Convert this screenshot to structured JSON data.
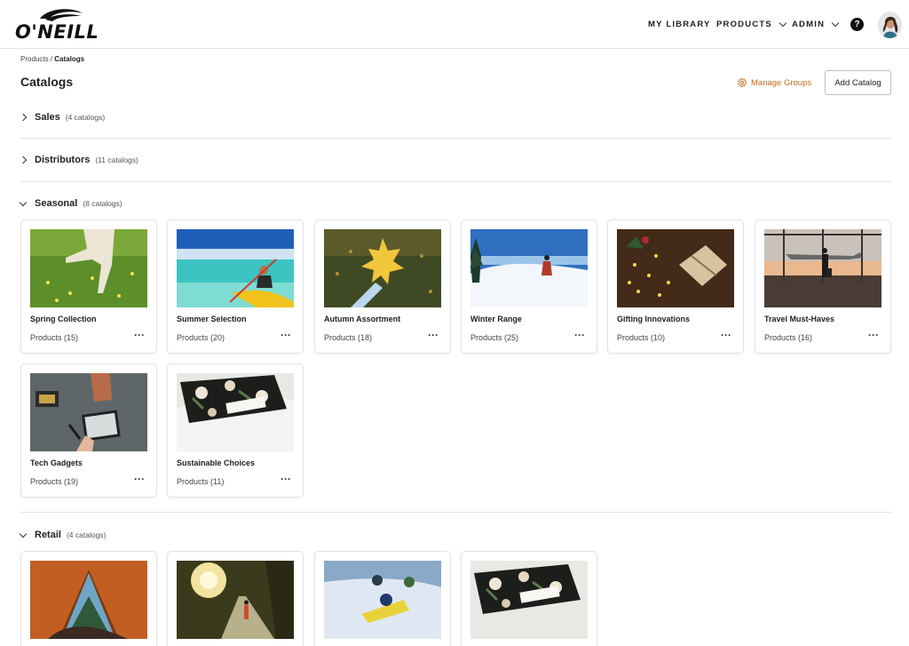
{
  "brand": {
    "logo_text": "O'NEILL"
  },
  "nav": {
    "my_library": "MY LIBRARY",
    "products": "PRODUCTS",
    "admin": "ADMIN",
    "help": "?"
  },
  "breadcrumb": {
    "parent": "Products",
    "separator": " / ",
    "current": "Catalogs"
  },
  "page": {
    "title": "Catalogs",
    "manage_groups": "Manage Groups",
    "add_catalog": "Add Catalog"
  },
  "colors": {
    "accent": "#c26a1f"
  },
  "groups": [
    {
      "name": "Sales",
      "count": "(4 catalogs)",
      "expanded": false
    },
    {
      "name": "Distributors",
      "count": "(11 catalogs)",
      "expanded": false
    },
    {
      "name": "Seasonal",
      "count": "(8 catalogs)",
      "expanded": true,
      "catalogs": [
        {
          "name": "Spring Collection",
          "products": "Products (15)"
        },
        {
          "name": "Summer Selection",
          "products": "Products (20)"
        },
        {
          "name": "Autumn Assortment",
          "products": "Products (18)"
        },
        {
          "name": "Winter Range",
          "products": "Products (25)"
        },
        {
          "name": "Gifting Innovations",
          "products": "Products (10)"
        },
        {
          "name": "Travel Must-Haves",
          "products": "Products (16)"
        },
        {
          "name": "Tech Gadgets",
          "products": "Products (19)"
        },
        {
          "name": "Sustainable Choices",
          "products": "Products (11)"
        }
      ]
    },
    {
      "name": "Retail",
      "count": "(4 catalogs)",
      "expanded": true
    }
  ],
  "card_menu": "···"
}
